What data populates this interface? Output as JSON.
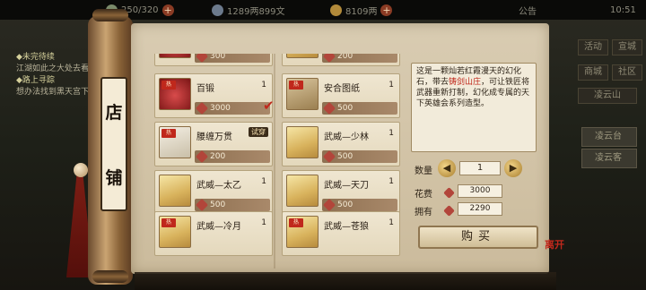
{
  "top_bar": {
    "stamina": "250/320",
    "silver": "1289两899文",
    "gold": "8109两",
    "announce": "公告",
    "time": "10:51"
  },
  "quests": [
    {
      "title": "◆未完待续",
      "desc": "江湖如此之大处去看看"
    },
    {
      "title": "◆路上寻踪",
      "desc": "想办法找到黑天宫下落"
    }
  ],
  "side_buttons": {
    "activity": "活动",
    "recharge": "宣城",
    "mall": "商城",
    "social": "社区"
  },
  "right_tabs": {
    "cloud": "凌云山",
    "side1": "凌云台",
    "side2": "凌云客"
  },
  "shop": {
    "title_chars": [
      "店",
      "铺"
    ],
    "currency_icon": "ruby-gem-icon",
    "items": [
      {
        "name": "",
        "qty": "",
        "price": "300",
        "icon": "red",
        "tag": ""
      },
      {
        "name": "",
        "qty": "",
        "price": "200",
        "icon": "scroll",
        "tag": ""
      },
      {
        "name": "百锻",
        "qty": "1",
        "price": "3000",
        "icon": "red",
        "tag": "热",
        "selected": true
      },
      {
        "name": "安合图纸",
        "qty": "1",
        "price": "500",
        "icon": "book",
        "tag": "热"
      },
      {
        "name": "腰缠万贯",
        "qty": "",
        "price": "200",
        "icon": "belt",
        "tag": "热",
        "badge": "试穿"
      },
      {
        "name": "武威—少林",
        "qty": "1",
        "price": "500",
        "icon": "scroll",
        "tag": ""
      },
      {
        "name": "武威—太乙",
        "qty": "1",
        "price": "500",
        "icon": "scroll",
        "tag": ""
      },
      {
        "name": "武威—天刀",
        "qty": "1",
        "price": "500",
        "icon": "scroll",
        "tag": ""
      },
      {
        "name": "武威—冷月",
        "qty": "1",
        "price": "",
        "icon": "scroll",
        "tag": "热"
      },
      {
        "name": "武威—苍狼",
        "qty": "1",
        "price": "",
        "icon": "scroll",
        "tag": "热"
      }
    ],
    "detail": {
      "desc_pre": "这是一颗灿若红霞漫天的幻化石，带去",
      "desc_hl": "铸剑山庄",
      "desc_post": "，可让铁匠将武器重新打制，幻化成专属的天下英雄会系列造型。",
      "qty_label": "数量",
      "qty_value": "1",
      "cost_label": "花费",
      "cost_value": "3000",
      "own_label": "拥有",
      "own_value": "2290",
      "buy_label": "购买",
      "close_label": "离开"
    }
  },
  "colors": {
    "accent_red": "#c0281c",
    "paper": "#d9ccb2",
    "price_bar": "#8e7051"
  }
}
